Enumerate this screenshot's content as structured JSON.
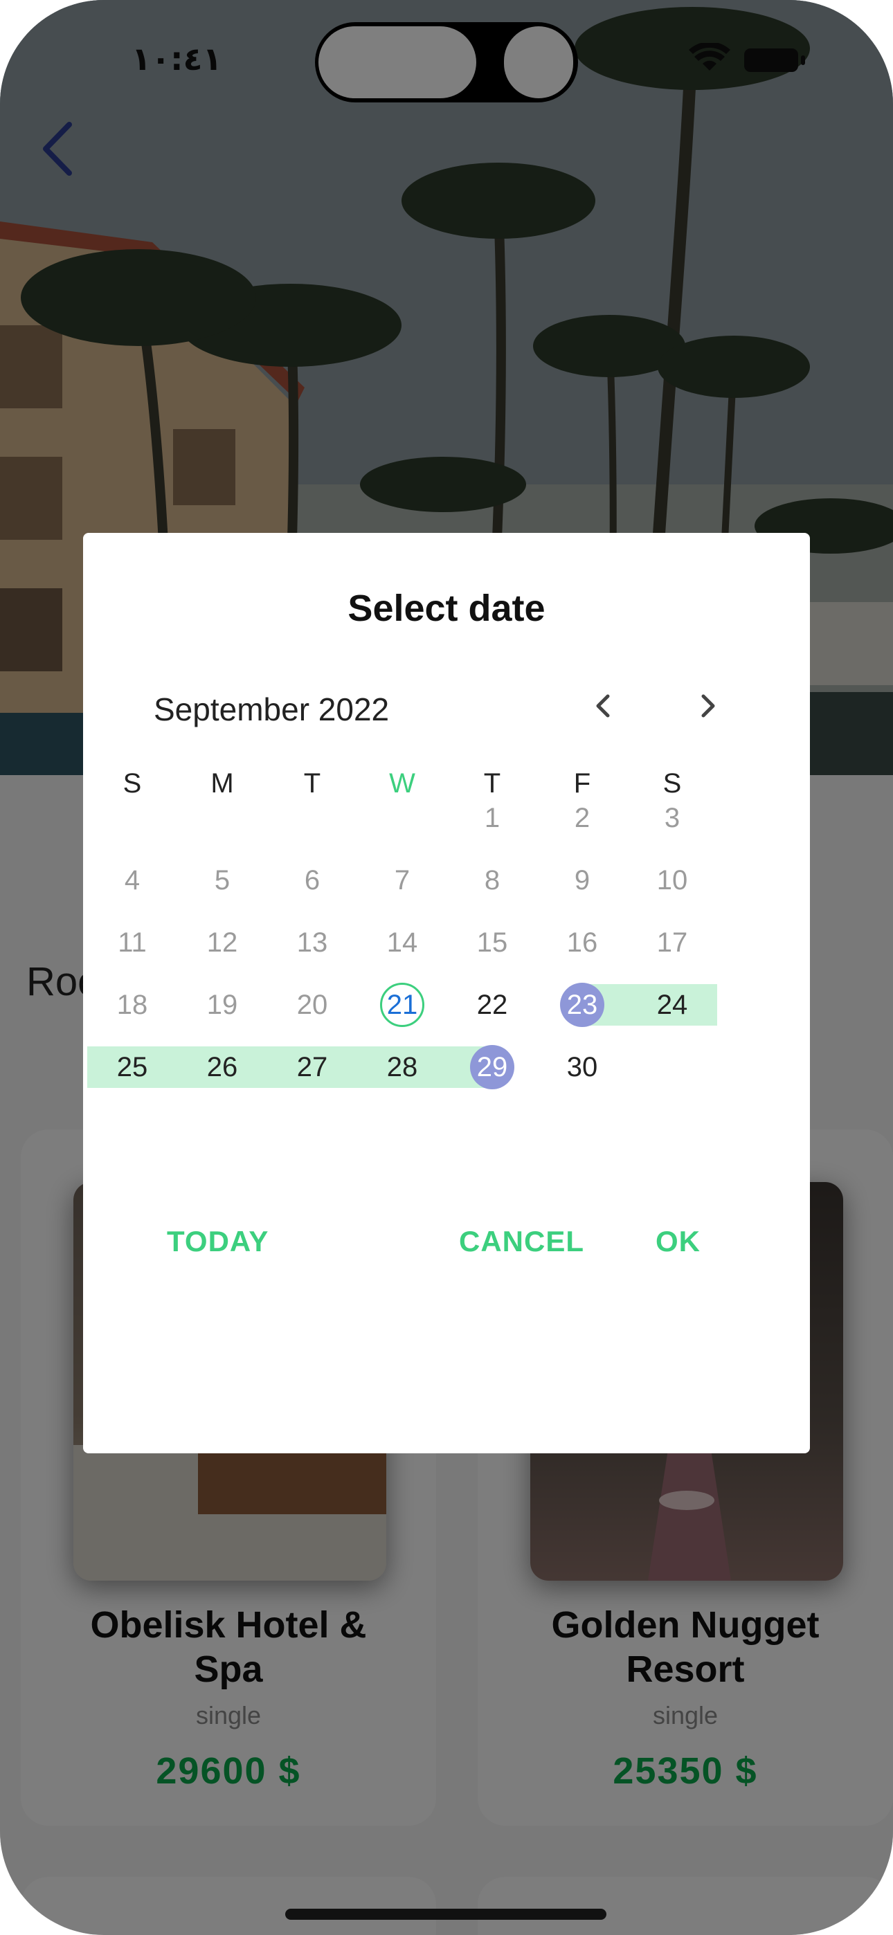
{
  "status": {
    "time": "١٠:٤١"
  },
  "page": {
    "section_title_partial": "Roo",
    "hotels": [
      {
        "name_line1": "Obelisk Hotel &",
        "name_line2": "Spa",
        "type": "single",
        "price": "29600  $"
      },
      {
        "name_line1": "Golden Nugget",
        "name_line2": "Resort",
        "type": "single",
        "price": "25350  $"
      }
    ]
  },
  "dialog": {
    "title": "Select date",
    "month": "September 2022",
    "weekdays": [
      "S",
      "M",
      "T",
      "W",
      "T",
      "F",
      "S"
    ],
    "today_weekday_index": 3,
    "weeks": [
      [
        "",
        "",
        "",
        "",
        "1",
        "2",
        "3"
      ],
      [
        "4",
        "5",
        "6",
        "7",
        "8",
        "9",
        "10"
      ],
      [
        "11",
        "12",
        "13",
        "14",
        "15",
        "16",
        "17"
      ],
      [
        "18",
        "19",
        "20",
        "21",
        "22",
        "23",
        "24"
      ],
      [
        "25",
        "26",
        "27",
        "28",
        "29",
        "30",
        ""
      ]
    ],
    "today_day": "21",
    "range_start": "23",
    "range_end": "29",
    "buttons": {
      "today": "TODAY",
      "cancel": "CANCEL",
      "ok": "OK"
    }
  },
  "colors": {
    "accent": "#3ccf7e",
    "range_fill": "#c9f2d9",
    "selected_circle": "#8e97d8",
    "price": "#0aa64a"
  },
  "icons": [
    "back-chevron-icon",
    "wifi-icon",
    "battery-icon",
    "chevron-left-icon",
    "chevron-right-icon"
  ]
}
